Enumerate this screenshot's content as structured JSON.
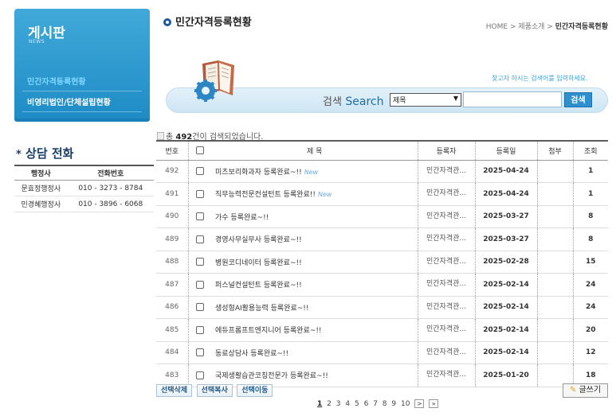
{
  "sidebar": {
    "title": "게시판",
    "subtitle": "NEWS",
    "items": [
      {
        "label": "민간자격등록현황"
      },
      {
        "label": "비영리법인/단체설립현황"
      }
    ]
  },
  "consult": {
    "title": "상담 전화",
    "headers": [
      "행정사",
      "전화번호"
    ],
    "rows": [
      {
        "name": "문효정행정사",
        "phone": "010 - 3273 - 8784"
      },
      {
        "name": "민경혜행정사",
        "phone": "010 - 3896 - 6068"
      }
    ]
  },
  "header": {
    "title": "민간자격등록현황",
    "breadcrumb_prefix": "HOME > 제품소개 >",
    "breadcrumb_current": "민간자격등록현황"
  },
  "search": {
    "hint": "찾고자 하시는 검색어를 입력하세요.",
    "label_ko": "검색",
    "label_en": "Search",
    "select_value": "제목",
    "input_value": "",
    "button": "검색"
  },
  "count": {
    "prefix": "총",
    "total": "492",
    "suffix": "건이 검색되었습니다."
  },
  "table": {
    "headers": {
      "num": "번호",
      "subject": "제 목",
      "writer": "등록자",
      "date": "등록일",
      "attach": "첨부",
      "hits": "조회"
    },
    "rows": [
      {
        "num": "492",
        "subject": "미츠보리화과자 등록완료~!!",
        "new": "New",
        "writer": "민간자격관...",
        "date": "2025-04-24",
        "hits": "1"
      },
      {
        "num": "491",
        "subject": "직무능력전문컨설턴트 등록완료!!",
        "new": "New",
        "writer": "민간자격관...",
        "date": "2025-04-24",
        "hits": "1"
      },
      {
        "num": "490",
        "subject": "가수 등록완료~!!",
        "new": "",
        "writer": "민간자격관...",
        "date": "2025-03-27",
        "hits": "8"
      },
      {
        "num": "489",
        "subject": "경영사무실무사 등록완료~!!",
        "new": "",
        "writer": "민간자격관...",
        "date": "2025-03-27",
        "hits": "8"
      },
      {
        "num": "488",
        "subject": "병원코디네이터 등록완료~!!",
        "new": "",
        "writer": "민간자격관...",
        "date": "2025-02-28",
        "hits": "15"
      },
      {
        "num": "487",
        "subject": "퍼스널컨설턴트 등록완료~!!",
        "new": "",
        "writer": "민간자격관...",
        "date": "2025-02-14",
        "hits": "24"
      },
      {
        "num": "486",
        "subject": "생성형AI활용능력 등록완료~!!",
        "new": "",
        "writer": "민간자격관...",
        "date": "2025-02-14",
        "hits": "24"
      },
      {
        "num": "485",
        "subject": "에듀프롬프트엔지니어 등록완료~!!",
        "new": "",
        "writer": "민간자격관...",
        "date": "2025-02-14",
        "hits": "20"
      },
      {
        "num": "484",
        "subject": "동료상담사 등록완료~!!",
        "new": "",
        "writer": "민간자격관...",
        "date": "2025-02-14",
        "hits": "12"
      },
      {
        "num": "483",
        "subject": "국제생활습관코칭전문가 등록완료~!!",
        "new": "",
        "writer": "민간자격관...",
        "date": "2025-01-20",
        "hits": "18"
      }
    ]
  },
  "actions": {
    "delete": "선택삭제",
    "copy": "선택복사",
    "move": "선택이동",
    "write": "글쓰기"
  },
  "pagination": {
    "pages": [
      "1",
      "2",
      "3",
      "4",
      "5",
      "6",
      "7",
      "8",
      "9",
      "10"
    ],
    "current": "1",
    "next": ">",
    "last": "»"
  }
}
